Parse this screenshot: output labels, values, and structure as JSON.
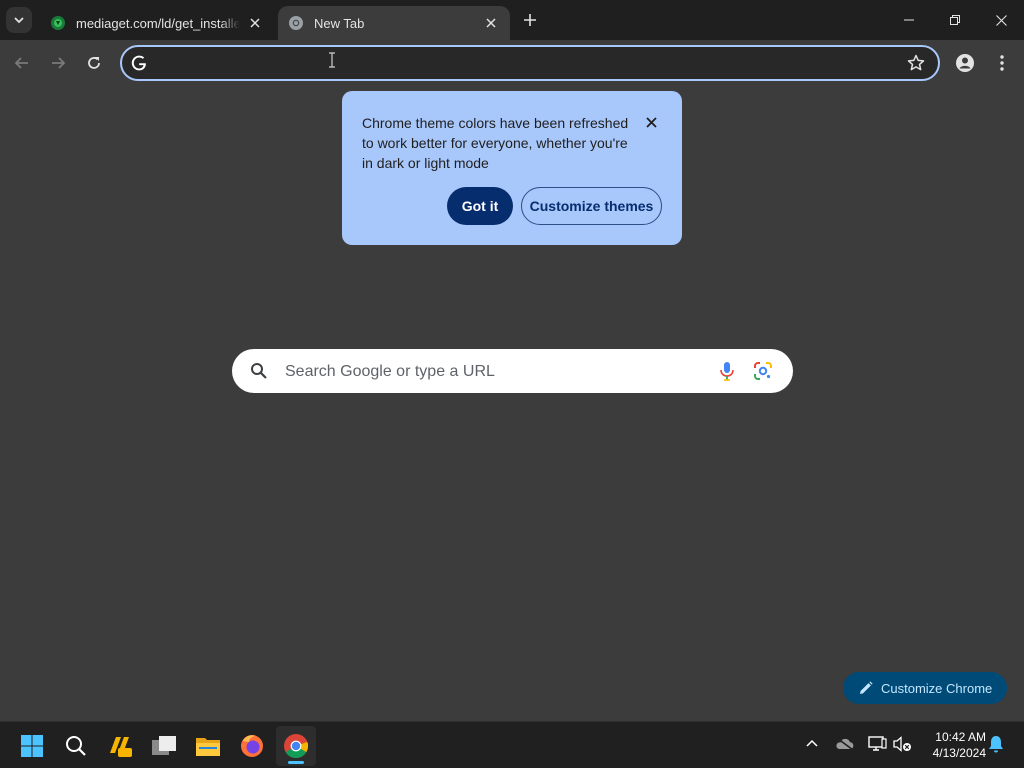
{
  "tabs": [
    {
      "title": "mediaget.com/ld/get_installer.php",
      "active": false,
      "favicon": "mediaget-favicon"
    },
    {
      "title": "New Tab",
      "active": true,
      "favicon": "chrome-favicon"
    }
  ],
  "omnibox": {
    "value": "",
    "placeholder": ""
  },
  "bubble": {
    "text": "Chrome theme colors have been refreshed to work better for everyone, whether you're in dark or light mode",
    "got_it": "Got it",
    "customize_themes": "Customize themes"
  },
  "ntp_search": {
    "placeholder": "Search Google or type a URL"
  },
  "customize_chrome": "Customize Chrome",
  "taskbar": {
    "apps": [
      "start-icon",
      "search-icon",
      "app-pre-icon",
      "task-view-icon",
      "file-explorer-icon",
      "firefox-icon",
      "chrome-icon"
    ],
    "time": "10:42 AM",
    "date": "4/13/2024"
  },
  "colors": {
    "tab_strip": "#1f1f1f",
    "toolbar": "#3c3c3c",
    "bubble": "#a8c7fa",
    "primary_button": "#062e6f",
    "customize_button": "#004a77"
  }
}
